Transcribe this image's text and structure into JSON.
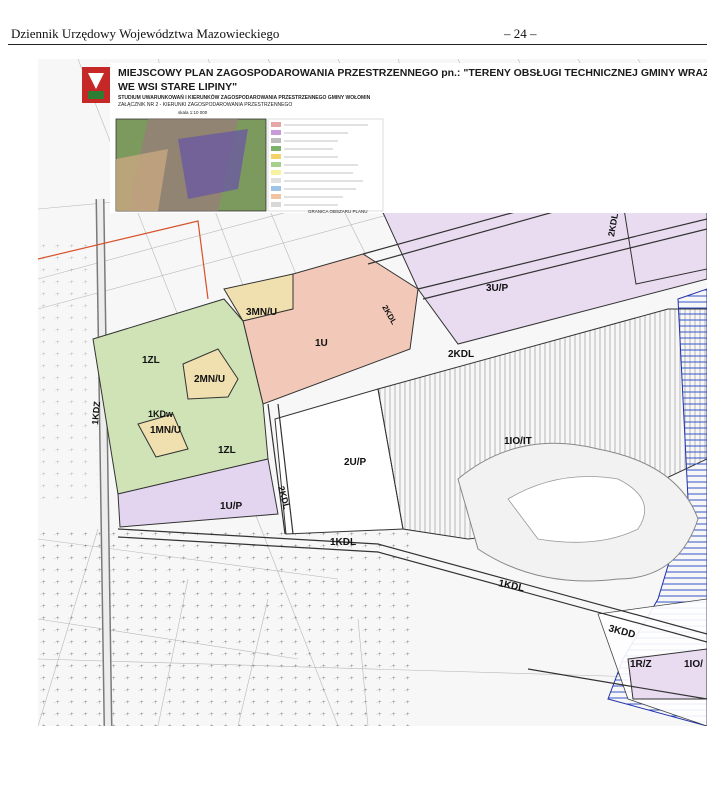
{
  "header": {
    "journal": "Dziennik Urzędowy Województwa Mazowieckiego",
    "page": "– 24 –"
  },
  "map": {
    "title_line1": "MIEJSCOWY PLAN ZAGOSPODAROWANIA PRZESTRZENNEGO pn.: \"TERENY OBSŁUGI TECHNICZNEJ GMINY WRAZ Z",
    "title_line2": "WE WSI STARE LIPINY\"",
    "subtitle": "STUDIUM UWARUNKOWAŃ I KIERUNKÓW ZAGOSPODAROWANIA PRZESTRZENNEGO GMINY WOŁOMIN",
    "attachment": "ZAŁĄCZNIK NR 2 - KIERUNKI ZAGOSPODAROWANIA PRZESTRZENNEGO",
    "scale": "skala 1:10 000",
    "legend_footer": "GRANICA OBSZARU PLANU",
    "zones": {
      "u3p": "3U/P",
      "mnu3": "3MN/U",
      "u1": "1U",
      "zl1a": "1ZL",
      "mnu2": "2MN/U",
      "mnu1": "1MN/U",
      "kdw": "1KDw",
      "zl1b": "1ZL",
      "u1p": "1U/P",
      "u2p": "2U/P",
      "io1": "1IO/IT",
      "kdl1": "1KDL",
      "kdl2a": "2KDL",
      "kdl2b": "2KDL",
      "kdl2c": "2KDL",
      "kdl2d": "2KDL",
      "kdl1b": "1KDL",
      "kdd3": "3KDD",
      "rz1": "1R/Z",
      "io_edge": "1IO/",
      "kdz": "1KDZ"
    }
  }
}
